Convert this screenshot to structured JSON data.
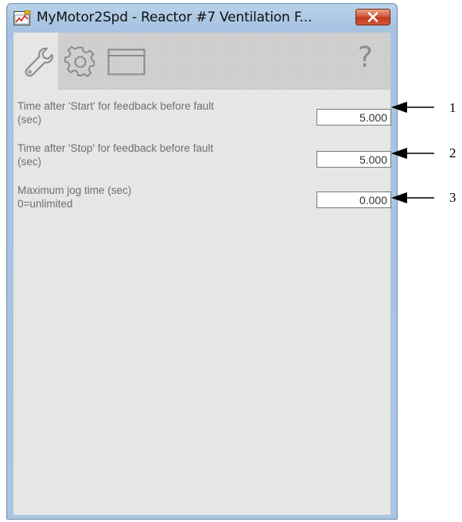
{
  "window": {
    "title": "MyMotor2Spd - Reactor #7 Ventilation F..."
  },
  "toolbar": {
    "tabs": [
      {
        "name": "wrench-icon"
      },
      {
        "name": "gear-icon"
      },
      {
        "name": "window-icon"
      }
    ],
    "help_label": "?"
  },
  "params": [
    {
      "label_line1": "Time after 'Start' for feedback before fault",
      "label_line2": "(sec)",
      "value": "5.000",
      "callout": "1"
    },
    {
      "label_line1": "Time after 'Stop' for feedback before fault",
      "label_line2": "(sec)",
      "value": "5.000",
      "callout": "2"
    },
    {
      "label_line1": "Maximum jog time (sec)",
      "label_line2": "0=unlimited",
      "value": "0.000",
      "callout": "3"
    }
  ],
  "colors": {
    "frame": "#a9c6e3",
    "client": "#e6e6e6",
    "toolbar": "#d4d4d4",
    "close": "#c94a2c"
  }
}
